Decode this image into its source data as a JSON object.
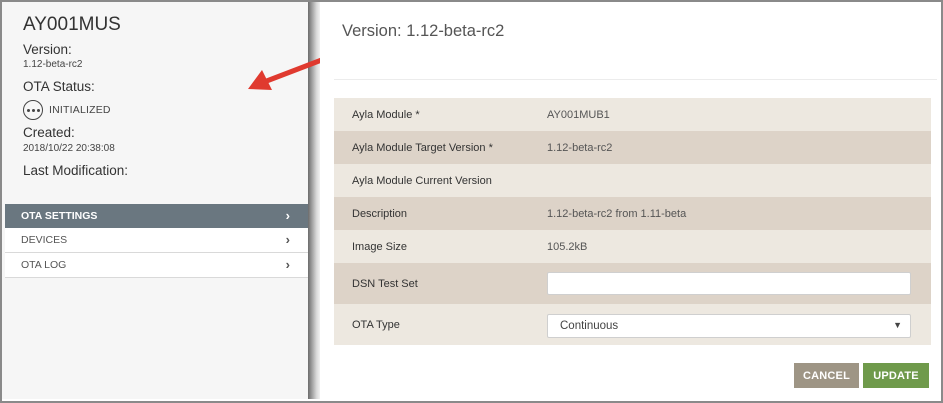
{
  "device": {
    "name": "AY001MUS",
    "version_label": "Version:",
    "version_value": "1.12-beta-rc2",
    "ota_status_label": "OTA Status:",
    "ota_status_value": "INITIALIZED",
    "created_label": "Created:",
    "created_value": "2018/10/22 20:38:08",
    "last_mod_label": "Last Modification:"
  },
  "nav": {
    "items": [
      {
        "label": "OTA SETTINGS",
        "active": true
      },
      {
        "label": "DEVICES",
        "active": false
      },
      {
        "label": "OTA LOG",
        "active": false
      }
    ]
  },
  "main": {
    "title": "Version: 1.12-beta-rc2",
    "rows": [
      {
        "key": "Ayla Module *",
        "value": "AY001MUB1"
      },
      {
        "key": "Ayla Module Target Version *",
        "value": "1.12-beta-rc2"
      },
      {
        "key": "Ayla Module Current Version",
        "value": ""
      },
      {
        "key": "Description",
        "value": "1.12-beta-rc2 from 1.11-beta"
      },
      {
        "key": "Image Size",
        "value": "105.2kB"
      },
      {
        "key": "DSN Test Set",
        "value": ""
      },
      {
        "key": "OTA Type",
        "value": "Continuous"
      }
    ],
    "cancel_label": "CANCEL",
    "update_label": "UPDATE"
  },
  "icons": {
    "status": "status-dots-icon",
    "nav_chevron": "chevron-right-icon",
    "select_caret": "caret-down-icon",
    "annotation": "red-arrow-icon"
  },
  "colors": {
    "nav_active": "#6a7780",
    "row_light": "#ede8e0",
    "row_dark": "#ddd3c8",
    "cancel": "#9e9585",
    "update": "#6f9a4b",
    "arrow": "#e03a2f"
  }
}
